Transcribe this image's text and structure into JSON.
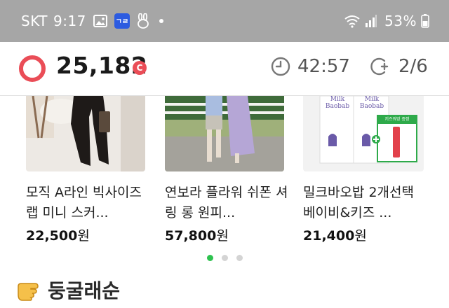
{
  "status_bar": {
    "carrier": "SKT",
    "time": "9:17",
    "battery": "53%",
    "icons": [
      "gallery-icon",
      "app-badge-icon",
      "rabbit-icon",
      "dot-icon",
      "wifi-icon",
      "signal-icon",
      "battery-icon"
    ]
  },
  "header": {
    "points": "25,182",
    "coin_symbol": "C",
    "timer": "42:57",
    "progress": "2/6"
  },
  "products": [
    {
      "title": "모직 A라인 빅사이즈 랩 미니 스커...",
      "price": "22,500",
      "unit": "원"
    },
    {
      "title": "연보라 플라워 쉬폰 셔링 롱 원피...",
      "price": "57,800",
      "unit": "원"
    },
    {
      "title": "밀크바오밥 2개선택 베이비&키즈 ...",
      "price": "21,400",
      "unit": "원"
    }
  ],
  "product3_image": {
    "brand_line1": "Milk",
    "brand_line2": "Baobab",
    "promo_tag": "키즈워밍 증정"
  },
  "carousel": {
    "pages": 3,
    "active_page": 1
  },
  "section": {
    "title": "둥굴래순"
  },
  "colors": {
    "status_bar": "#a6a6a6",
    "accent_red": "#ea4d57",
    "active_dot": "#2ec24f"
  }
}
